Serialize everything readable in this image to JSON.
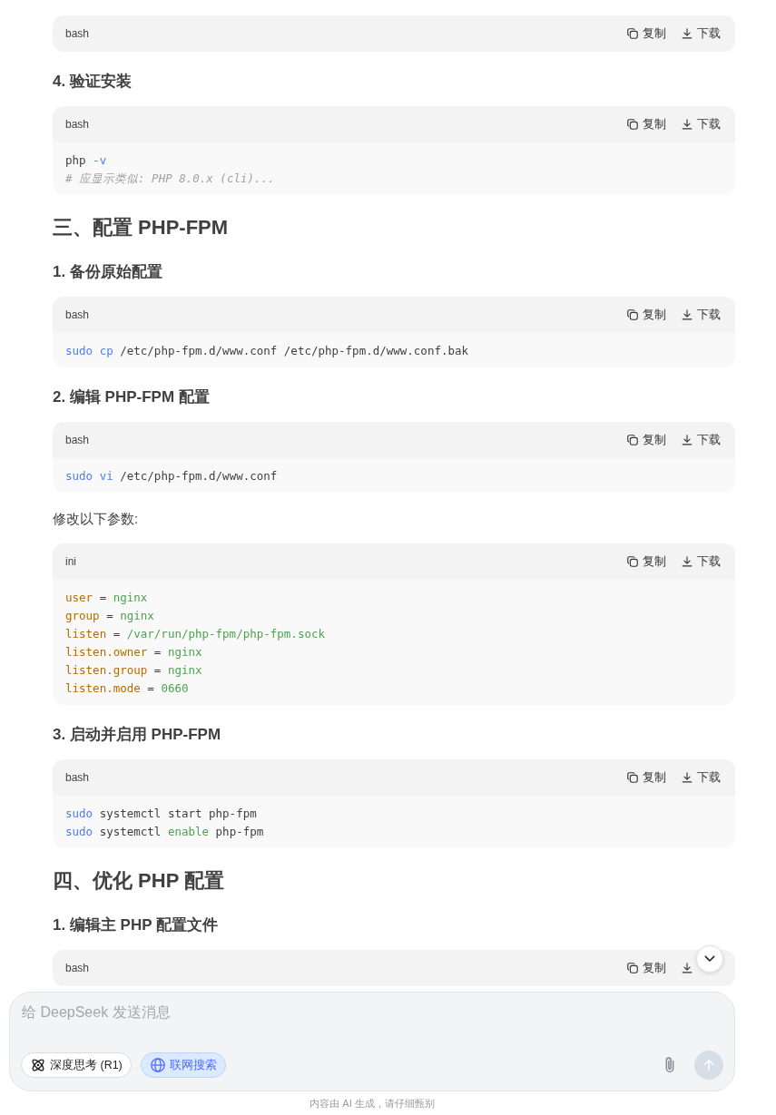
{
  "content": [
    {
      "kind": "code",
      "lang": "bash",
      "copy": "复制",
      "download": "下载"
    },
    {
      "kind": "h3",
      "text": "4. 验证安装"
    },
    {
      "kind": "code",
      "lang": "bash",
      "copy": "复制",
      "download": "下载",
      "lines": [
        [
          {
            "t": "php ",
            "kind": "plain"
          },
          {
            "t": "-v",
            "kind": "builtin"
          }
        ],
        [
          {
            "t": "# 应显示类似: PHP 8.0.x (cli)...",
            "kind": "comment"
          }
        ]
      ]
    },
    {
      "kind": "h2",
      "text": "三、配置 PHP-FPM"
    },
    {
      "kind": "h3",
      "text": "1. 备份原始配置"
    },
    {
      "kind": "code",
      "lang": "bash",
      "copy": "复制",
      "download": "下载",
      "lines": [
        [
          {
            "t": "sudo ",
            "kind": "builtin"
          },
          {
            "t": "cp",
            "kind": "builtin"
          },
          {
            "t": " /etc/php-fpm.d/www.conf /etc/php-fpm.d/www.conf.bak",
            "kind": "plain"
          }
        ]
      ]
    },
    {
      "kind": "h3",
      "text": "2. 编辑 PHP-FPM 配置"
    },
    {
      "kind": "code",
      "lang": "bash",
      "copy": "复制",
      "download": "下载",
      "lines": [
        [
          {
            "t": "sudo ",
            "kind": "builtin"
          },
          {
            "t": "vi",
            "kind": "builtin"
          },
          {
            "t": " /etc/php-fpm.d/www.conf",
            "kind": "plain"
          }
        ]
      ]
    },
    {
      "kind": "p",
      "text": "修改以下参数:"
    },
    {
      "kind": "code",
      "lang": "ini",
      "copy": "复制",
      "download": "下载",
      "lines": [
        [
          {
            "t": "user",
            "kind": "key"
          },
          {
            "t": " = ",
            "kind": "plain"
          },
          {
            "t": "nginx",
            "kind": "value"
          }
        ],
        [
          {
            "t": "group",
            "kind": "key"
          },
          {
            "t": " = ",
            "kind": "plain"
          },
          {
            "t": "nginx",
            "kind": "value"
          }
        ],
        [
          {
            "t": "listen",
            "kind": "key"
          },
          {
            "t": " = ",
            "kind": "plain"
          },
          {
            "t": "/var/run/php-fpm/php-fpm.sock",
            "kind": "value"
          }
        ],
        [
          {
            "t": "listen.owner",
            "kind": "key"
          },
          {
            "t": " = ",
            "kind": "plain"
          },
          {
            "t": "nginx",
            "kind": "value"
          }
        ],
        [
          {
            "t": "listen.group",
            "kind": "key"
          },
          {
            "t": " = ",
            "kind": "plain"
          },
          {
            "t": "nginx",
            "kind": "value"
          }
        ],
        [
          {
            "t": "listen.mode",
            "kind": "key"
          },
          {
            "t": " = ",
            "kind": "plain"
          },
          {
            "t": "0660",
            "kind": "value"
          }
        ]
      ]
    },
    {
      "kind": "h3",
      "text": "3. 启动并启用 PHP-FPM"
    },
    {
      "kind": "code",
      "lang": "bash",
      "copy": "复制",
      "download": "下载",
      "lines": [
        [
          {
            "t": "sudo",
            "kind": "builtin"
          },
          {
            "t": " systemctl start php-fpm",
            "kind": "plain"
          }
        ],
        [
          {
            "t": "sudo",
            "kind": "builtin"
          },
          {
            "t": " systemctl ",
            "kind": "plain"
          },
          {
            "t": "enable",
            "kind": "value"
          },
          {
            "t": " php-fpm",
            "kind": "plain"
          }
        ]
      ]
    },
    {
      "kind": "h2",
      "text": "四、优化 PHP 配置"
    },
    {
      "kind": "h3",
      "text": "1. 编辑主 PHP 配置文件"
    },
    {
      "kind": "code",
      "lang": "bash",
      "copy": "复制"
    }
  ],
  "composer": {
    "placeholder": "给 DeepSeek 发送消息",
    "toggles": [
      {
        "kind": "think",
        "label": "深度思考 (R1)",
        "selected": false
      },
      {
        "kind": "web",
        "label": "联网搜索",
        "selected": true
      }
    ],
    "send_disabled": true
  },
  "footer": "内容由 AI 生成，请仔细甄别"
}
